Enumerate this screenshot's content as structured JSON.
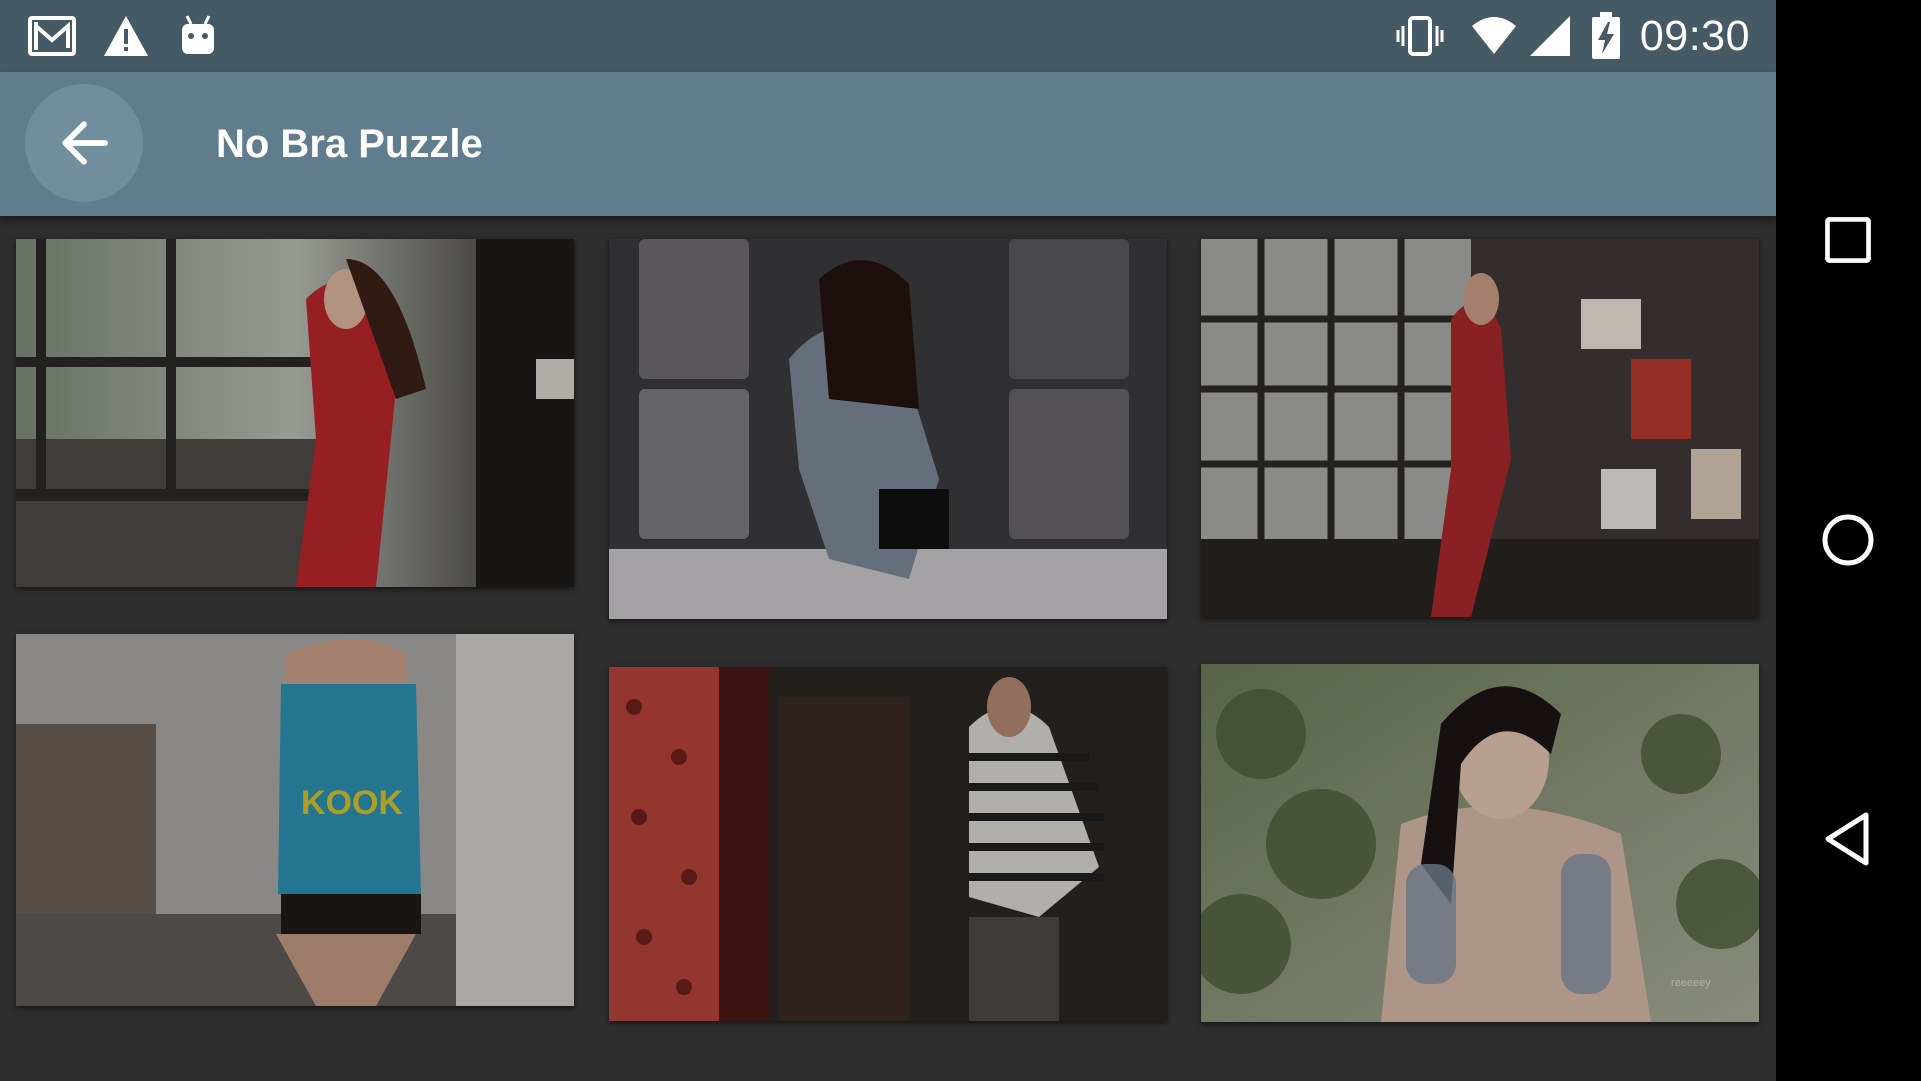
{
  "status_bar": {
    "time": "09:30",
    "left_icons": [
      "gmail-icon",
      "warning-icon",
      "android-debug-icon"
    ],
    "right_icons": [
      "vibrate-icon",
      "wifi-icon",
      "cell-signal-icon",
      "battery-charging-icon"
    ]
  },
  "app_bar": {
    "title": "No Bra Puzzle",
    "back_icon": "arrow-back-icon",
    "color": "#5f7d8c"
  },
  "gallery": {
    "tiles": [
      {
        "name": "photo-tile-1",
        "palette": "red dress by window"
      },
      {
        "name": "photo-tile-2",
        "palette": "grey shirt on bed"
      },
      {
        "name": "photo-tile-3",
        "palette": "red robe in loft"
      },
      {
        "name": "photo-tile-4",
        "palette": "blue tank top"
      },
      {
        "name": "photo-tile-5",
        "palette": "striped top red curtain"
      },
      {
        "name": "photo-tile-6",
        "palette": "tattooed outdoor portrait"
      }
    ]
  },
  "nav_bar": {
    "buttons": [
      "recents-square-icon",
      "home-circle-icon",
      "back-triangle-icon"
    ]
  },
  "colors": {
    "status_bar": "#455a64",
    "app_bar": "#5f7d8c",
    "background": "#2e2e2e"
  }
}
